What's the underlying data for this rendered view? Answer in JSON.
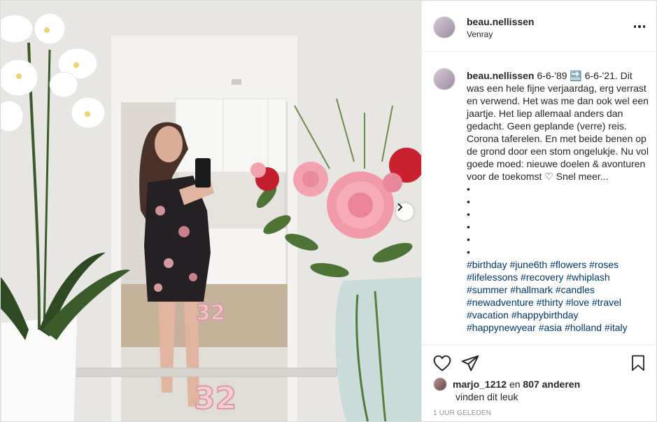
{
  "post": {
    "username": "beau.nellissen",
    "location": "Venray",
    "caption": "6-6-'89 🔜 6-6-'21. Dit was een hele fijne verjaardag, erg verrast en verwend. Het was me dan ook wel een jaartje. Het liep allemaal anders dan gedacht. Geen geplande (verre) reis. Corona taferelen. En met beide benen op de grond door een stom ongelukje. Nu vol goede moed: nieuwe doelen & avonturen voor de toekomst ♡ Snel meer...",
    "dots": [
      "•",
      "•",
      "•",
      "•",
      "•",
      "•"
    ],
    "hashtags": "#birthday #june6th #flowers #roses #lifelessons #recovery #whiplash #summer #hallmark #candles #newadventure #thirty #love #travel #vacation #happybirthday #happynewyear #asia #holland #italy",
    "liked_by_user": "marjo_1212",
    "likes_mid": " en ",
    "likes_others": "807 anderen",
    "likes_suffix": "vinden dit leuk",
    "timestamp": "1 UUR GELEDEN"
  },
  "photo": {
    "candle_text": "32"
  },
  "icons": {
    "more": "more-options-icon",
    "next": "chevron-right-icon",
    "like": "heart-icon",
    "share": "paper-plane-icon",
    "save": "bookmark-icon"
  }
}
